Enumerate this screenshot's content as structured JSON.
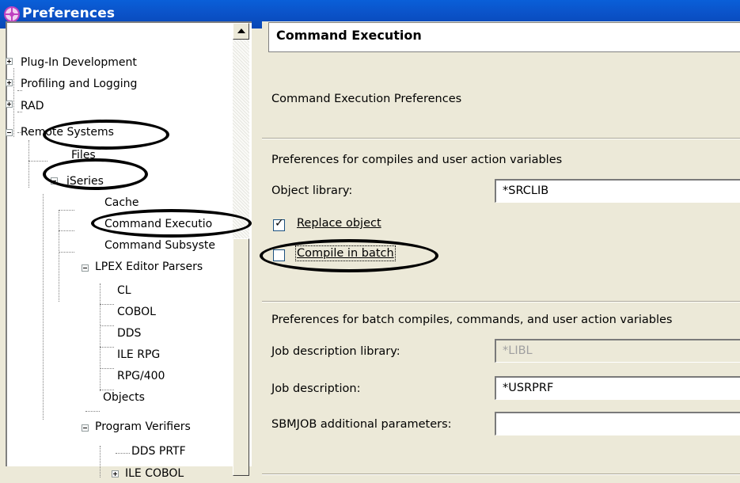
{
  "window": {
    "title": "Preferences"
  },
  "tree": {
    "items": [
      {
        "label": "Plug-In Development",
        "expander": "plus"
      },
      {
        "label": "Profiling and Logging",
        "expander": "plus"
      },
      {
        "label": "RAD",
        "expander": "plus"
      },
      {
        "label": "Remote Systems",
        "expander": "minus"
      },
      {
        "label": "Files"
      },
      {
        "label": "iSeries",
        "expander": "minus"
      },
      {
        "label": "Cache"
      },
      {
        "label": "Command Executio"
      },
      {
        "label": "Command Subsyste"
      },
      {
        "label": "LPEX Editor Parsers",
        "expander": "minus"
      },
      {
        "label": "CL"
      },
      {
        "label": "COBOL"
      },
      {
        "label": "DDS"
      },
      {
        "label": "ILE RPG"
      },
      {
        "label": "RPG/400"
      },
      {
        "label": "Objects"
      },
      {
        "label": "Program Verifiers",
        "expander": "minus"
      },
      {
        "label": "DDS PRTF"
      },
      {
        "label": "ILE COBOL",
        "expander": "plus"
      }
    ]
  },
  "page": {
    "header": "Command Execution",
    "description": "Command Execution Preferences",
    "compile_section": {
      "heading": "Preferences for compiles and user action variables",
      "object_library_label": "Object library:",
      "object_library_value": "*SRCLIB",
      "replace_object_label": "Replace object",
      "replace_object_checked": true,
      "compile_in_batch_label": "Compile in batch",
      "compile_in_batch_checked": false
    },
    "batch_section": {
      "heading": "Preferences for batch compiles, commands, and user action variables",
      "job_description_library_label": "Job description library:",
      "job_description_library_value": "*LIBL",
      "job_description_label": "Job description:",
      "job_description_value": "*USRPRF",
      "sbmjob_label": "SBMJOB additional parameters:",
      "sbmjob_value": ""
    }
  },
  "colors": {
    "titlebar": "#0b53c9",
    "window_bg": "#ece9d8",
    "annotation": "#000000"
  }
}
